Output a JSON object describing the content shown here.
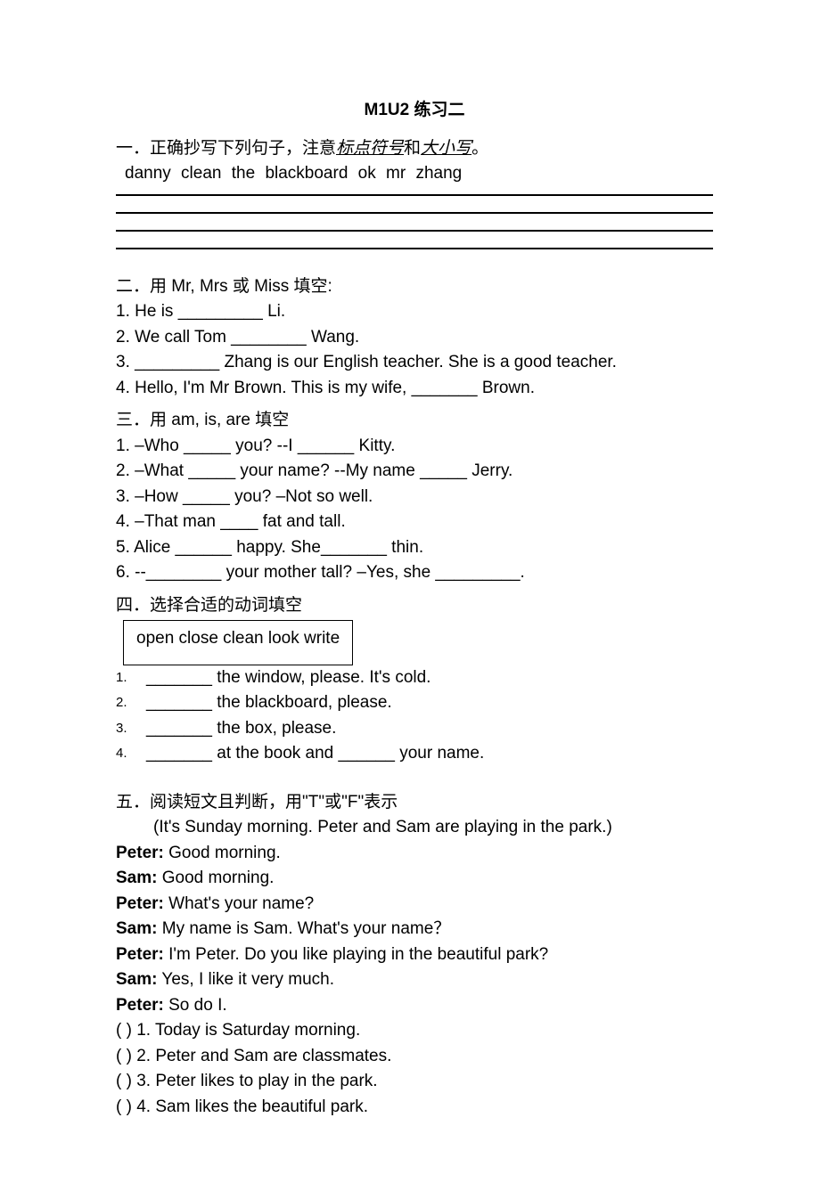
{
  "title": "M1U2 练习二",
  "section1": {
    "heading_prefix": "一．正确抄写下列句子，注意",
    "heading_u1": "标点符号",
    "heading_mid": "和",
    "heading_u2": "大小写",
    "heading_suffix": "。",
    "copy_text": "danny   clean the blackboard            ok   mr   zhang"
  },
  "section2": {
    "heading": "二．用 Mr, Mrs 或 Miss 填空:",
    "items": [
      "1. He is _________ Li.",
      "2. We call Tom ________ Wang.",
      "3. _________ Zhang is our English teacher. She is a good teacher.",
      "4. Hello, I'm Mr Brown. This is my wife, _______ Brown."
    ]
  },
  "section3": {
    "heading": "三．用 am, is, are 填空",
    "items": [
      "1. –Who _____ you?   --I ______ Kitty.",
      "2. –What _____ your name?   --My name _____ Jerry.",
      "3. –How _____ you? –Not so well.",
      "4. –That man ____ fat and tall.",
      "5. Alice ______ happy. She_______ thin.",
      "6. --________ your mother tall? –Yes, she _________."
    ]
  },
  "section4": {
    "heading": "四．选择合适的动词填空",
    "word_box": "open   close   clean   look   write",
    "items": [
      "_______ the window, please. It's cold.",
      "_______ the blackboard, please.",
      "_______ the box, please.",
      "_______ at the book and ______ your name."
    ],
    "nums": [
      "1.",
      "2.",
      "3.",
      "4."
    ]
  },
  "section5": {
    "heading": "五．阅读短文且判断，用\"T\"或\"F\"表示",
    "intro": "(It's Sunday morning. Peter and Sam are playing in the park.)",
    "dialogue": [
      {
        "s": "Peter:",
        "t": " Good morning."
      },
      {
        "s": "Sam:",
        "t": " Good morning."
      },
      {
        "s": "Peter:",
        "t": " What's your name?"
      },
      {
        "s": "Sam:",
        "t": " My name is Sam. What's your name？"
      },
      {
        "s": "Peter:",
        "t": " I'm Peter. Do you like playing in the beautiful park?"
      },
      {
        "s": "Sam:",
        "t": " Yes, I like it very much."
      },
      {
        "s": "Peter:",
        "t": " So do I."
      }
    ],
    "tf": [
      "(      ) 1. Today is Saturday morning.",
      "(      ) 2. Peter and Sam are classmates.",
      "(      ) 3. Peter likes to play in the park.",
      "(      ) 4. Sam likes the beautiful park."
    ]
  }
}
